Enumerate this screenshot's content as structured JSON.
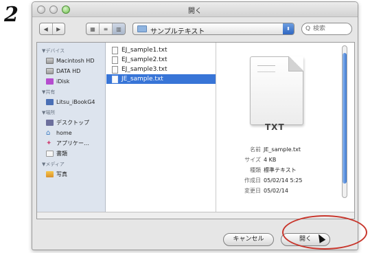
{
  "step_number": "2",
  "window": {
    "title": "開く"
  },
  "toolbar": {
    "nav_back": "◀",
    "nav_forward": "▶",
    "view_icons": "▦",
    "view_list": "≡",
    "view_columns": "▥",
    "location": "サンプルテキスト",
    "location_arrows": "⬍",
    "search_icon": "Q",
    "search_placeholder": "検索"
  },
  "sidebar": {
    "sections": [
      {
        "heading": "▼デバイス",
        "items": [
          {
            "label": "Macintosh HD",
            "icon": "hard-disk-icon"
          },
          {
            "label": "DATA HD",
            "icon": "hard-disk-icon"
          },
          {
            "label": "iDisk",
            "icon": "idisk-icon"
          }
        ]
      },
      {
        "heading": "▼共有",
        "items": [
          {
            "label": "Litsu_iBookG4",
            "icon": "shared-computer-icon"
          }
        ]
      },
      {
        "heading": "▼場所",
        "items": [
          {
            "label": "デスクトップ",
            "icon": "desktop-icon"
          },
          {
            "label": "home",
            "icon": "home-icon"
          },
          {
            "label": "アプリケー…",
            "icon": "applications-icon"
          },
          {
            "label": "書類",
            "icon": "documents-icon"
          }
        ]
      },
      {
        "heading": "▼メディア",
        "items": [
          {
            "label": "写真",
            "icon": "photos-icon"
          }
        ]
      }
    ]
  },
  "files": [
    {
      "name": "EJ_sample1.txt",
      "selected": false
    },
    {
      "name": "EJ_sample2.txt",
      "selected": false
    },
    {
      "name": "EJ_sample3.txt",
      "selected": false
    },
    {
      "name": "JE_sample.txt",
      "selected": true
    }
  ],
  "preview": {
    "type_label": "TXT",
    "info": [
      {
        "key": "名前",
        "value": "JE_sample.txt"
      },
      {
        "key": "サイズ",
        "value": "4 KB"
      },
      {
        "key": "種類",
        "value": "標準テキスト"
      },
      {
        "key": "作成日",
        "value": "05/02/14 5:25"
      },
      {
        "key": "変更日",
        "value": "05/02/14"
      }
    ]
  },
  "buttons": {
    "cancel": "キャンセル",
    "open": "開く"
  },
  "colors": {
    "selection": "#3875d7",
    "annotation": "#c8352b",
    "sidebar_bg": "#dde4ee"
  }
}
